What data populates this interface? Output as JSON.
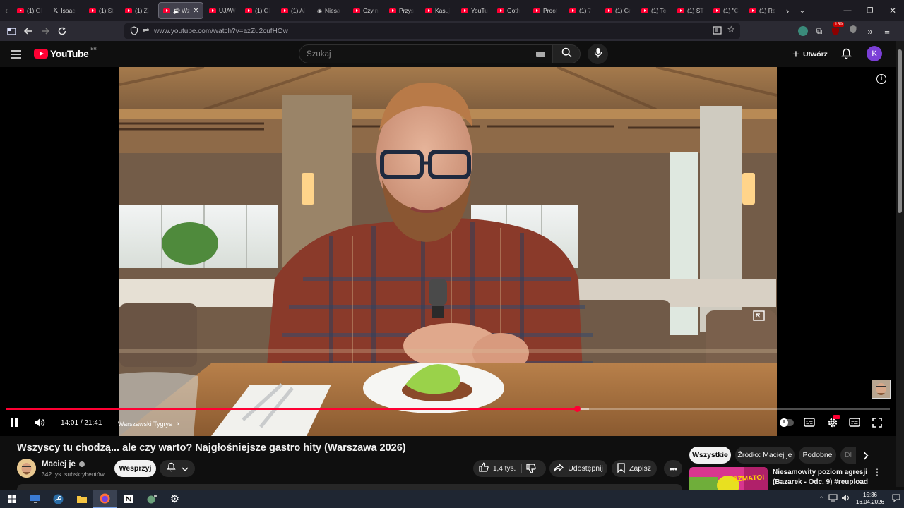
{
  "browser": {
    "tabs": [
      {
        "label": "(1) Gł",
        "icon": "youtube-icon"
      },
      {
        "label": "Isaac",
        "icon": "x-icon"
      },
      {
        "label": "(1) St",
        "icon": "youtube-icon"
      },
      {
        "label": "(1) Zj",
        "icon": "youtube-icon"
      },
      {
        "label": "Wz",
        "icon": "youtube-icon",
        "active": true
      },
      {
        "label": "UJAW",
        "icon": "youtube-icon"
      },
      {
        "label": "(1) Ol",
        "icon": "youtube-icon"
      },
      {
        "label": "(1) Al",
        "icon": "youtube-icon"
      },
      {
        "label": "Niesa",
        "icon": "generic-icon"
      },
      {
        "label": "Czy n",
        "icon": "youtube-icon"
      },
      {
        "label": "Przys",
        "icon": "youtube-icon"
      },
      {
        "label": "Kasuj",
        "icon": "youtube-icon"
      },
      {
        "label": "YouTu",
        "icon": "youtube-icon"
      },
      {
        "label": "Goth",
        "icon": "youtube-icon"
      },
      {
        "label": "Proof",
        "icon": "youtube-icon"
      },
      {
        "label": "(1) 7",
        "icon": "youtube-icon"
      },
      {
        "label": "(1) Gr",
        "icon": "youtube-icon"
      },
      {
        "label": "(1) To",
        "icon": "youtube-icon"
      },
      {
        "label": "(1) ST",
        "icon": "youtube-icon"
      },
      {
        "label": "(1) \"C",
        "icon": "youtube-icon"
      },
      {
        "label": "(1) Re",
        "icon": "youtube-icon"
      }
    ],
    "url": "www.youtube.com/watch?v=azZu2cufHOw",
    "extension_badge": "159"
  },
  "youtube": {
    "logo_text": "YouTube",
    "logo_region": "BR",
    "search_placeholder": "Szukaj",
    "create_label": "Utwórz",
    "avatar_letter": "K",
    "accent": "#ff0033"
  },
  "player": {
    "time_current": "14:01",
    "time_separator": "/",
    "time_total": "21:41",
    "chapter": "Warszawski Tygrys",
    "chapter_chevron": "›",
    "progress_fraction": 0.6465
  },
  "video": {
    "title": "Wszyscy tu chodzą... ale czy warto? Najgłośniejsze gastro hity (Warszawa 2026)",
    "channel": "Maciej je",
    "subscribers": "342 tys. subskrybentów",
    "support_label": "Wesprzyj",
    "likes": "1,4 tys.",
    "share_label": "Udostępnij",
    "save_label": "Zapisz"
  },
  "chips": [
    "Wszystkie",
    "Źródło: Maciej je",
    "Podobne",
    "Dl"
  ],
  "recommendation": {
    "title_line1": "Niesamowity poziom agresji",
    "title_line2": "(Bazarek - Odc. 9) #reupload",
    "thumb_text": "SZMATO!"
  },
  "taskbar": {
    "time": "15:36",
    "date": "16.04.2026"
  }
}
